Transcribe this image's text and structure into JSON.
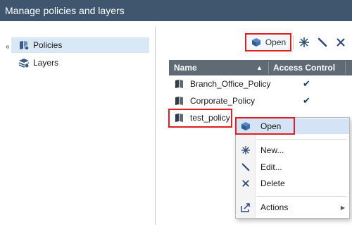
{
  "window": {
    "title": "Manage policies and layers"
  },
  "sidebar": {
    "collapse_glyph": "«",
    "items": [
      {
        "label": "Policies",
        "icon": "policies-icon",
        "selected": true
      },
      {
        "label": "Layers",
        "icon": "layers-icon",
        "selected": false
      }
    ]
  },
  "toolbar": {
    "open_label": "Open",
    "buttons": [
      "new-star-icon",
      "edit-pencil-icon",
      "delete-x-icon"
    ]
  },
  "table": {
    "columns": {
      "name": "Name",
      "sort_glyph": "▲",
      "access": "Access Control"
    },
    "rows": [
      {
        "name": "Branch_Office_Policy",
        "check": "✔"
      },
      {
        "name": "Corporate_Policy",
        "check": "✔"
      },
      {
        "name": "test_policy",
        "check": ""
      }
    ]
  },
  "context_menu": {
    "items": [
      {
        "label": "Open",
        "icon": "open-box-icon"
      },
      {
        "label": "New...",
        "icon": "new-star-icon"
      },
      {
        "label": "Edit...",
        "icon": "edit-pencil-icon"
      },
      {
        "label": "Delete",
        "icon": "delete-x-icon"
      },
      {
        "label": "Actions",
        "icon": "actions-share-icon",
        "submenu_glyph": "▶"
      }
    ]
  },
  "colors": {
    "titlebar": "#40566f",
    "table_header": "#606a75",
    "highlight": "#e02020",
    "selection": "#d9e8f6"
  }
}
